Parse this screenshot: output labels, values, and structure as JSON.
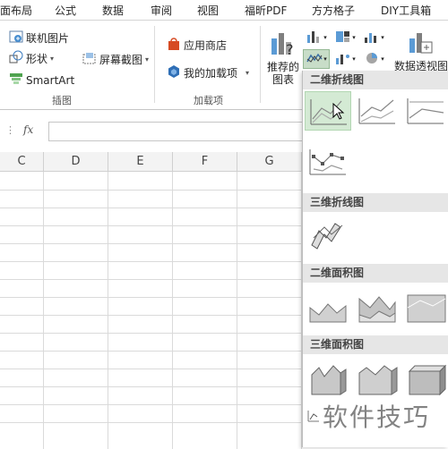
{
  "tabs": [
    "面布局",
    "公式",
    "数据",
    "审阅",
    "视图",
    "福昕PDF",
    "方方格子",
    "DIY工具箱"
  ],
  "ribbon": {
    "illustrations": {
      "online_picture": "联机图片",
      "shapes": "形状",
      "screenshot": "屏幕截图",
      "smartart": "SmartArt",
      "group_label": "插图"
    },
    "addins": {
      "store": "应用商店",
      "my_addins": "我的加载项",
      "group_label": "加载项"
    },
    "charts": {
      "recommended_line1": "推荐的",
      "recommended_line2": "图表",
      "pivot_chart": "数据透视图"
    }
  },
  "formula_bar": {
    "fx": "fx",
    "value": ""
  },
  "sheet": {
    "columns": [
      "C",
      "D",
      "E",
      "F",
      "G"
    ]
  },
  "dropdown": {
    "sections": [
      {
        "title": "二维折线图",
        "icons": [
          "line-chart-icon",
          "stacked-line-chart-icon",
          "percent-stacked-line-chart-icon",
          "line-with-markers-chart-icon"
        ]
      },
      {
        "title": "三维折线图",
        "icons": [
          "3d-line-chart-icon"
        ]
      },
      {
        "title": "二维面积图",
        "icons": [
          "area-chart-icon",
          "stacked-area-chart-icon",
          "percent-stacked-area-chart-icon"
        ]
      },
      {
        "title": "三维面积图",
        "icons": [
          "3d-area-chart-icon",
          "3d-stacked-area-chart-icon",
          "3d-percent-stacked-area-chart-icon"
        ]
      }
    ]
  },
  "watermark": "软件技巧"
}
